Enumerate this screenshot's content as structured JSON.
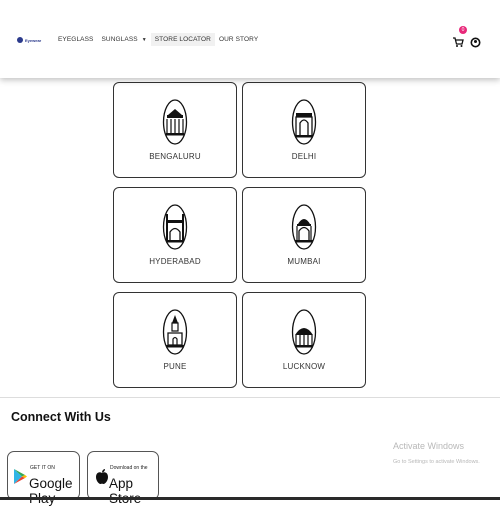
{
  "header": {
    "logo_text": "Eyewear",
    "nav": [
      {
        "label": "EYEGLASS"
      },
      {
        "label": "SUNGLASS"
      },
      {
        "label": "STORE LOCATOR"
      },
      {
        "label": "OUR STORY"
      }
    ],
    "cart_count": "0"
  },
  "cities": [
    {
      "name": "BENGALURU",
      "icon": "bengaluru-landmark-icon"
    },
    {
      "name": "DELHI",
      "icon": "delhi-landmark-icon"
    },
    {
      "name": "HYDERABAD",
      "icon": "hyderabad-landmark-icon"
    },
    {
      "name": "MUMBAI",
      "icon": "mumbai-landmark-icon"
    },
    {
      "name": "PUNE",
      "icon": "pune-landmark-icon"
    },
    {
      "name": "LUCKNOW",
      "icon": "lucknow-landmark-icon"
    }
  ],
  "footer": {
    "connect_title": "Connect With Us",
    "google_play": {
      "small": "GET IT ON",
      "big": "Google Play"
    },
    "app_store": {
      "small": "Download on the",
      "big": "App Store"
    }
  },
  "watermark": {
    "title": "Activate Windows",
    "subtitle": "Go to Settings to activate Windows."
  },
  "colors": {
    "accent": "#e8287a",
    "brand": "#2b3a8c"
  }
}
